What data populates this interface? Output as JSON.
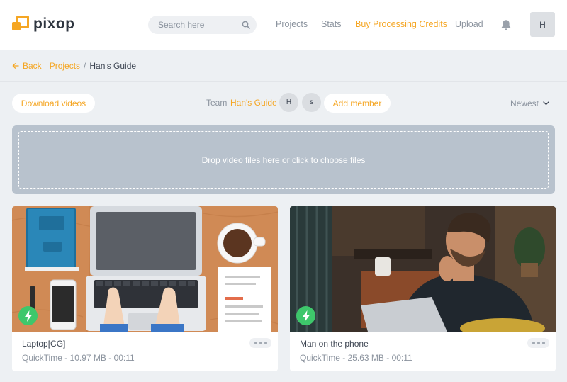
{
  "brand": {
    "name": "pixop",
    "accent": "#f5a623"
  },
  "search": {
    "placeholder": "Search here"
  },
  "nav": {
    "projects": "Projects",
    "stats": "Stats",
    "buy_credits": "Buy Processing Credits",
    "upload": "Upload"
  },
  "user": {
    "avatar_initial": "H"
  },
  "breadcrumb": {
    "back": "Back",
    "projects": "Projects",
    "separator": "/",
    "current": "Han's Guide"
  },
  "toolbar": {
    "download": "Download videos",
    "team_label": "Team",
    "team_name": "Han's Guide",
    "members": [
      "H",
      "s"
    ],
    "add_member": "Add member",
    "sort": "Newest"
  },
  "dropzone": {
    "text": "Drop video files here or click to choose files"
  },
  "videos": [
    {
      "title": "Laptop[CG]",
      "meta": "QuickTime - 10.97 MB - 00:11"
    },
    {
      "title": "Man on the phone",
      "meta": "QuickTime - 25.63 MB - 00:11"
    }
  ],
  "icons": [
    "search-icon",
    "bell-icon",
    "arrow-left-icon",
    "chevron-down-icon",
    "lightning-icon",
    "more-icon"
  ]
}
